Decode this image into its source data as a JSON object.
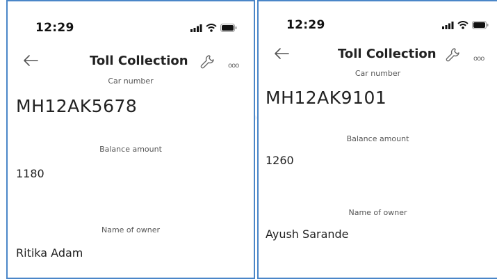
{
  "screens": [
    {
      "status": {
        "time": "12:29"
      },
      "nav": {
        "title": "Toll Collection",
        "back_icon": "arrow-left-icon",
        "wrench_icon": "wrench-icon",
        "more_icon": "more-dots-icon",
        "more_glyph": "ooo"
      },
      "fields": {
        "car_label": "Car number",
        "car_value": "MH12AK5678",
        "balance_label": "Balance amount",
        "balance_value": "1180",
        "owner_label": "Name of owner",
        "owner_value": "Ritika Adam"
      }
    },
    {
      "status": {
        "time": "12:29"
      },
      "nav": {
        "title": "Toll Collection",
        "back_icon": "arrow-left-icon",
        "wrench_icon": "wrench-icon",
        "more_icon": "more-dots-icon",
        "more_glyph": "ooo"
      },
      "fields": {
        "car_label": "Car number",
        "car_value": "MH12AK9101",
        "balance_label": "Balance amount",
        "balance_value": "1260",
        "owner_label": "Name of owner",
        "owner_value": "Ayush Sarande"
      }
    }
  ],
  "colors": {
    "frame_border": "#4a86c8",
    "text": "#222222",
    "background": "#ffffff"
  }
}
